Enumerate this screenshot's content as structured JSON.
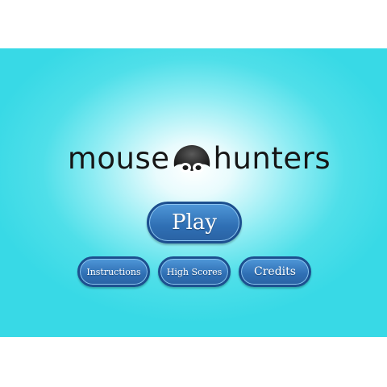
{
  "title": {
    "part1": "mouse",
    "part2": "hunters"
  },
  "menu": {
    "play_label": "Play",
    "instructions_label": "Instructions",
    "high_scores_label": "High Scores",
    "credits_label": "Credits"
  },
  "colors": {
    "background": "#38d9e6",
    "button": "#2f6fb4",
    "button_border": "#1c4f8f",
    "logo_text": "#161616"
  },
  "icons": {
    "logo_glyph": "mouse-head-icon"
  }
}
